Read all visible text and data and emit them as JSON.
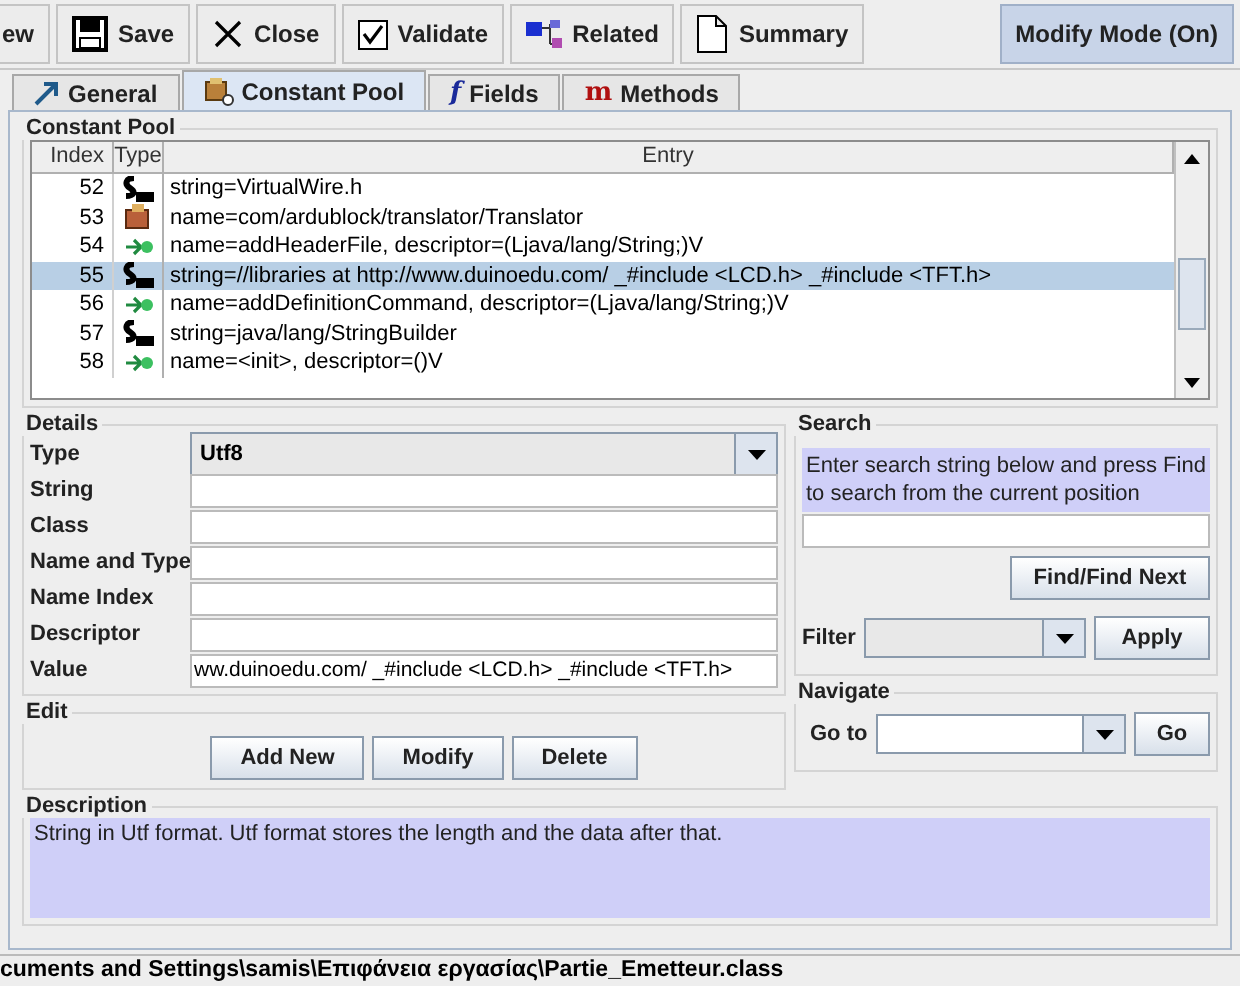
{
  "toolbar": {
    "buttons": [
      {
        "label": "ew"
      },
      {
        "label": "Save"
      },
      {
        "label": "Close"
      },
      {
        "label": "Validate"
      },
      {
        "label": "Related"
      },
      {
        "label": "Summary"
      }
    ],
    "mode_button": {
      "label": "Modify Mode (On)",
      "on": true
    }
  },
  "tabs": [
    {
      "label": "General",
      "selected": false
    },
    {
      "label": "Constant Pool",
      "selected": true
    },
    {
      "label": "Fields",
      "glyph": "f",
      "selected": false
    },
    {
      "label": "Methods",
      "glyph": "m",
      "selected": false
    }
  ],
  "constant_pool": {
    "title": "Constant Pool",
    "columns": [
      "Index",
      "Type",
      "Entry"
    ],
    "rows": [
      {
        "index": "52",
        "kind": "string",
        "entry": "string=VirtualWire.h",
        "selected": false
      },
      {
        "index": "53",
        "kind": "class",
        "entry": "name=com/ardublock/translator/Translator",
        "selected": false
      },
      {
        "index": "54",
        "kind": "nameandtype",
        "entry": "name=addHeaderFile, descriptor=(Ljava/lang/String;)V",
        "selected": false
      },
      {
        "index": "55",
        "kind": "string",
        "entry": "string=//libraries at http://www.duinoedu.com/ _#include <LCD.h> _#include <TFT.h>",
        "selected": true
      },
      {
        "index": "56",
        "kind": "nameandtype",
        "entry": "name=addDefinitionCommand, descriptor=(Ljava/lang/String;)V",
        "selected": false
      },
      {
        "index": "57",
        "kind": "string",
        "entry": "string=java/lang/StringBuilder",
        "selected": false
      },
      {
        "index": "58",
        "kind": "nameandtype",
        "entry": "name=<init>, descriptor=()V",
        "selected": false
      }
    ]
  },
  "details": {
    "title": "Details",
    "type": {
      "label": "Type",
      "value": "Utf8"
    },
    "fields": [
      {
        "label": "String"
      },
      {
        "label": "Class"
      },
      {
        "label": "Name and Type"
      },
      {
        "label": "Name Index"
      },
      {
        "label": "Descriptor"
      },
      {
        "label": "Value",
        "value": "ww.duinoedu.com/ _#include <LCD.h> _#include <TFT.h>"
      }
    ]
  },
  "search": {
    "title": "Search",
    "hint": "Enter search string below and press Find to search from the current position",
    "find_button": "Find/Find Next",
    "filter_label": "Filter",
    "apply_button": "Apply"
  },
  "edit": {
    "title": "Edit",
    "buttons": [
      "Add New",
      "Modify",
      "Delete"
    ]
  },
  "navigate": {
    "title": "Navigate",
    "goto_label": "Go to",
    "go_button": "Go"
  },
  "description": {
    "title": "Description",
    "text": "String in Utf format. Utf format stores the length and the data after that."
  },
  "status_bar": "cuments and Settings\\samis\\Επιφάνεια εργασίας\\Partie_Emetteur.class"
}
